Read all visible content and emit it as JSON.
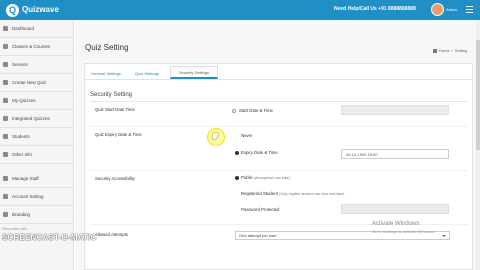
{
  "header": {
    "logo_text": "Quizwave",
    "helpline": "Need Help/Call Us +91 8888888888",
    "username": "Admin",
    "colors": {
      "accent": "#1f8fc6"
    }
  },
  "sidebar": {
    "items": [
      {
        "label": "Dashboard",
        "icon": "dashboard-icon"
      },
      {
        "label": "Classes & Courses",
        "icon": "classes-icon"
      },
      {
        "label": "Session",
        "icon": "session-icon"
      },
      {
        "label": "Create New Quiz",
        "icon": "create-quiz-icon"
      },
      {
        "label": "My Quizzes",
        "icon": "quizzes-icon"
      },
      {
        "label": "Integrated Quizzes",
        "icon": "integrated-icon"
      },
      {
        "label": "Students",
        "icon": "students-icon"
      },
      {
        "label": "Other Info",
        "icon": "info-icon"
      },
      {
        "label": "Manage Staff",
        "icon": "staff-icon"
      },
      {
        "label": "Account Setting",
        "icon": "account-icon"
      },
      {
        "label": "Branding",
        "icon": "branding-icon"
      }
    ]
  },
  "page": {
    "title": "Quiz Setting",
    "breadcrumb": [
      "Home",
      "Setting"
    ]
  },
  "tabs": [
    {
      "label": "General Settings",
      "active": false
    },
    {
      "label": "Quiz Settings",
      "active": false
    },
    {
      "label": "Security Settings",
      "active": true
    }
  ],
  "section": {
    "title": "Security Setting",
    "start": {
      "label": "Quiz Start Date Time",
      "option": "Start Date & Time"
    },
    "expiry": {
      "label": "Quiz Expiry Date & Time",
      "option_never": "Never",
      "option_expiry": "Expiry Date & Time",
      "value": "30-12-1999 18:00"
    },
    "accessibility": {
      "label": "Security Accessibility",
      "option_public": "Public",
      "option_public_hint": "(Anonymous can take)",
      "option_registered": "Registered Student",
      "option_registered_hint": "(Only register student can view and take)",
      "option_password": "Password Protected"
    },
    "attempts": {
      "label": "Allowed Attempts",
      "value": "One attempt per user"
    }
  },
  "overlays": {
    "watermark_top": "Recorded with",
    "watermark_brand": "SCREENCAST-O-MATIC",
    "activate_title": "Activate Windows",
    "activate_sub": "Go to Settings to activate Windows."
  }
}
